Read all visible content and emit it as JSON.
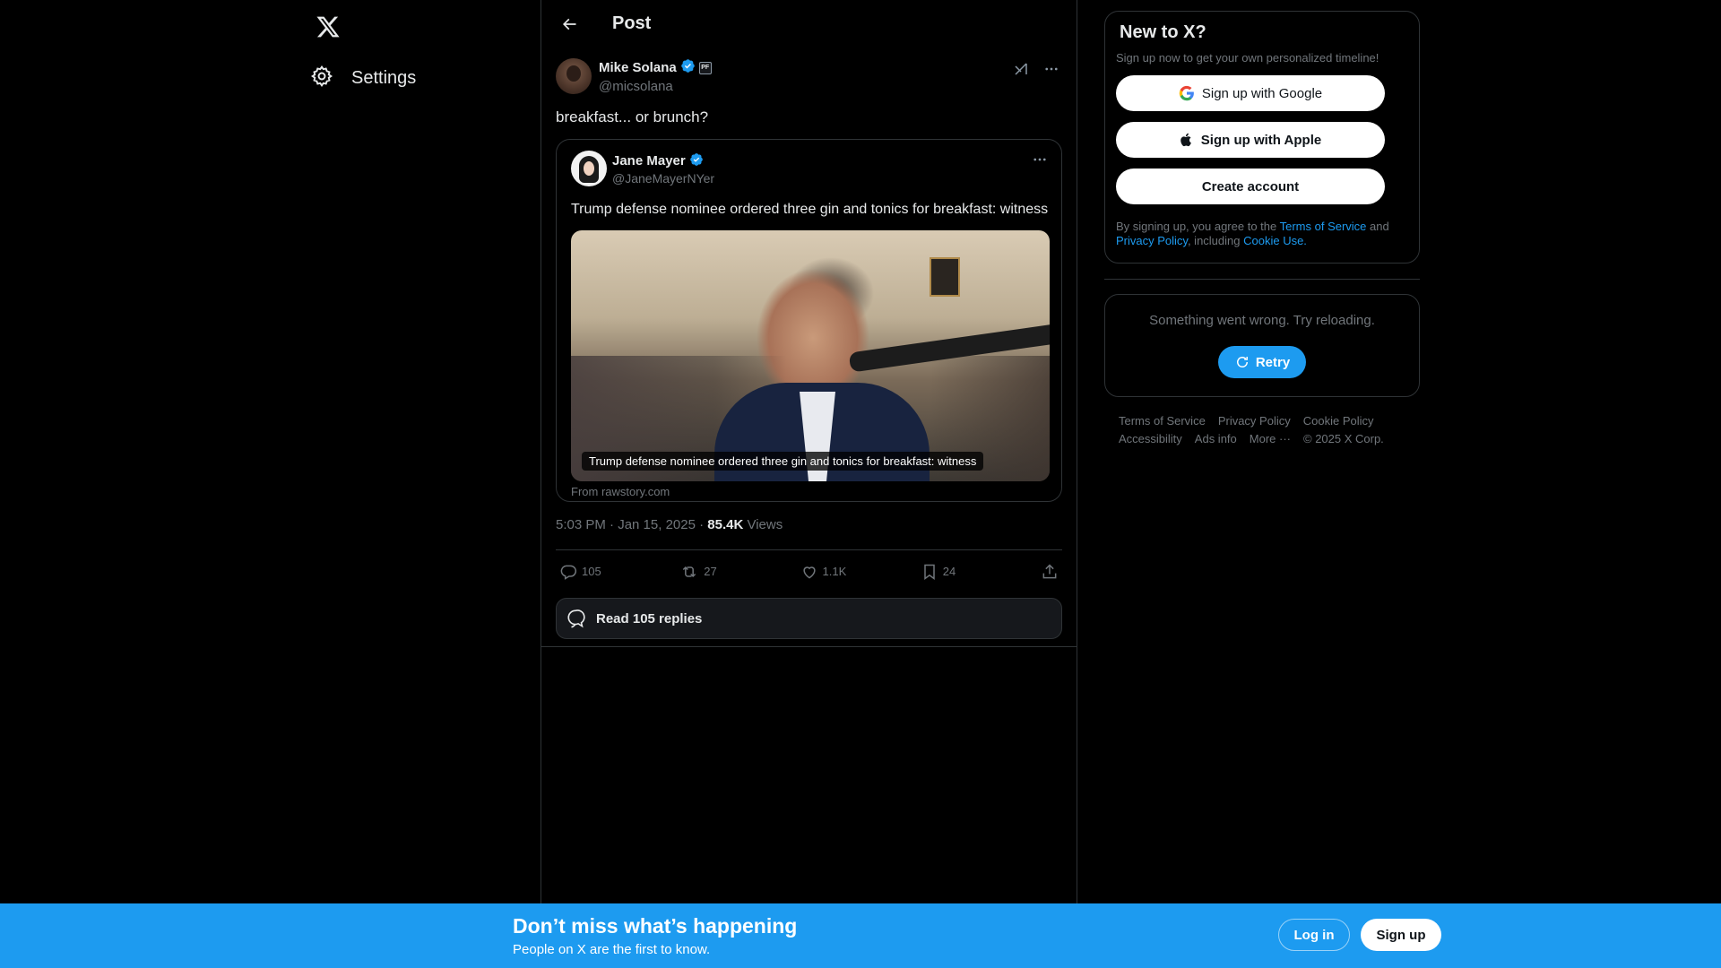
{
  "nav": {
    "settings_label": "Settings"
  },
  "header": {
    "title": "Post"
  },
  "post": {
    "author_name": "Mike Solana",
    "author_handle": "@micsolana",
    "affiliation_badge": "PF",
    "text": "breakfast... or brunch?",
    "timestamp": "5:03 PM · Jan 15, 2025 · ",
    "views_count": "85.4K",
    "views_label": "Views",
    "quote": {
      "author_name": "Jane Mayer",
      "author_handle": "@JaneMayerNYer",
      "text": "Trump defense nominee ordered three gin and tonics for breakfast: witness",
      "image_caption": "Trump defense nominee ordered three gin and tonics for breakfast: witness",
      "source": "From rawstory.com"
    },
    "stats": {
      "replies": "105",
      "reposts": "27",
      "likes": "1.1K",
      "bookmarks": "24"
    },
    "read_replies_label": "Read 105 replies"
  },
  "sidebar": {
    "signup_title": "New to X?",
    "signup_sub": "Sign up now to get your own personalized timeline!",
    "google_label": "Sign up with Google",
    "apple_label": "Sign up with Apple",
    "create_label": "Create account",
    "legal_prefix": "By signing up, you agree to the ",
    "terms_link": "Terms of Service",
    "legal_and": " and ",
    "privacy_link": "Privacy Policy",
    "legal_including": ", including ",
    "cookie_link": "Cookie Use.",
    "error_msg": "Something went wrong. Try reloading.",
    "retry_label": "Retry",
    "footer": {
      "terms": "Terms of Service",
      "privacy": "Privacy Policy",
      "cookie": "Cookie Policy",
      "accessibility": "Accessibility",
      "ads": "Ads info",
      "more": "More ···",
      "copyright": "© 2025 X Corp."
    }
  },
  "banner": {
    "title": "Don’t miss what’s happening",
    "subtitle": "People on X are the first to know.",
    "login_label": "Log in",
    "signup_label": "Sign up"
  },
  "colors": {
    "accent": "#1d9bf0",
    "background": "#000000",
    "border": "#2f3336",
    "muted": "#71767b"
  }
}
